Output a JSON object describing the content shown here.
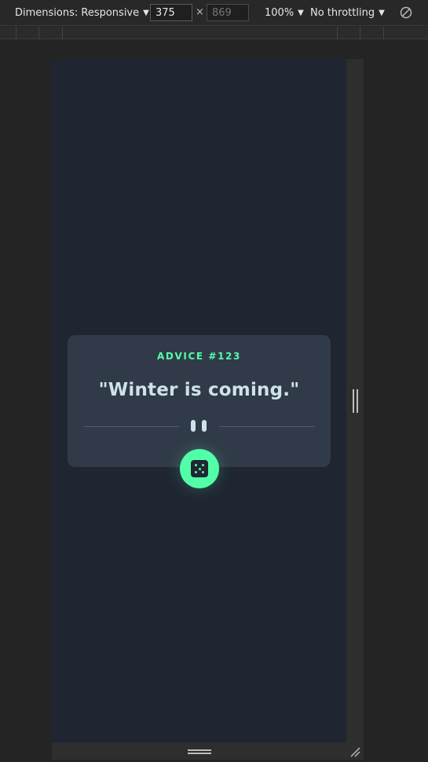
{
  "toolbar": {
    "dimensions_label": "Dimensions: Responsive",
    "width_value": "375",
    "height_placeholder": "869",
    "times_symbol": "×",
    "zoom_label": "100%",
    "throttling_label": "No throttling"
  },
  "app": {
    "advice_id": "ADVICE #123",
    "advice_text": "\"Winter is coming.\""
  },
  "colors": {
    "background": "#1f2632",
    "card": "#313a49",
    "accent": "#52ffa8",
    "text": "#cee3e9"
  },
  "icons": {
    "rotate": "rotate-icon",
    "dice": "dice-icon",
    "pause_divider": "pause-icon"
  }
}
